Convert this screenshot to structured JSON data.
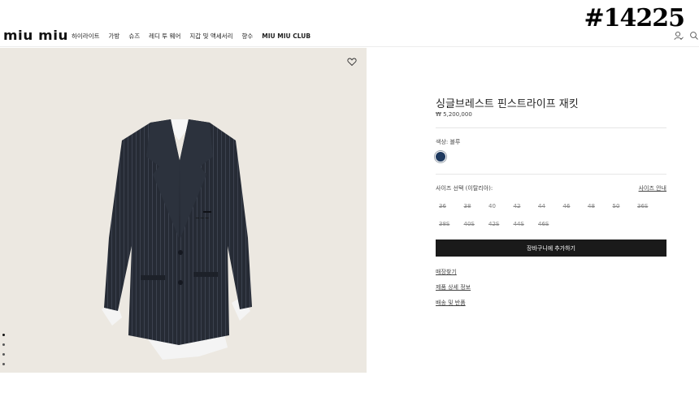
{
  "header": {
    "logo": "miu miu",
    "nav": [
      "하이라이트",
      "가방",
      "슈즈",
      "레디 투 웨어",
      "지갑 및 액세서리",
      "향수",
      "MIU MIU CLUB"
    ],
    "watermark": "#14225",
    "icons": [
      "user-icon",
      "search-icon"
    ]
  },
  "gallery": {
    "wishlist_icon": "heart-icon",
    "dot_count": 4,
    "active_dot": 0
  },
  "product": {
    "title": "싱글브레스트 핀스트라이프 재킷",
    "price": "₩ 5,200,000",
    "color_label": "색상: 블루",
    "color_swatch": "#1f3a5f",
    "size_label": "사이즈 선택 (이탈리아):",
    "size_guide": "사이즈 안내",
    "sizes_row1": [
      {
        "label": "36",
        "available": false
      },
      {
        "label": "38",
        "available": false
      },
      {
        "label": "40",
        "available": true
      },
      {
        "label": "42",
        "available": false
      },
      {
        "label": "44",
        "available": false
      },
      {
        "label": "46",
        "available": false
      },
      {
        "label": "48",
        "available": false
      },
      {
        "label": "50",
        "available": false
      },
      {
        "label": "36S",
        "available": false
      }
    ],
    "sizes_row2": [
      {
        "label": "38S",
        "available": false
      },
      {
        "label": "40S",
        "available": false
      },
      {
        "label": "42S",
        "available": false
      },
      {
        "label": "44S",
        "available": false
      },
      {
        "label": "46S",
        "available": false
      }
    ],
    "add_to_cart": "장바구니에 추가하기",
    "links": [
      "매장찾기",
      "제품 상세 정보",
      "배송 및 반품"
    ]
  }
}
